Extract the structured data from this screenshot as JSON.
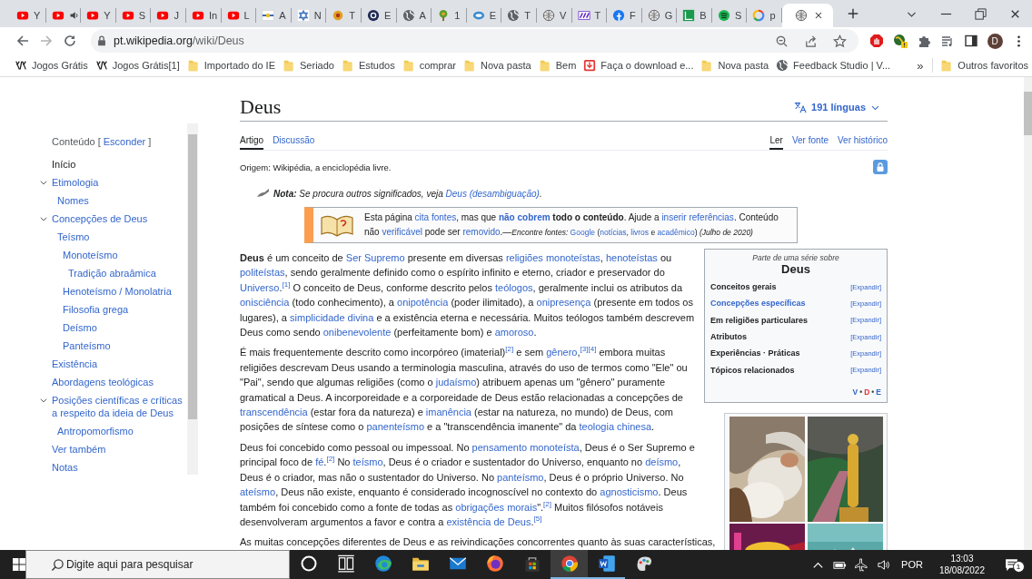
{
  "browser": {
    "tabs": [
      {
        "kind": "youtube",
        "title": "Y",
        "audio": false,
        "selected": false
      },
      {
        "kind": "youtube",
        "audio": true,
        "selected": false
      },
      {
        "kind": "youtube",
        "title": "Y",
        "audio": false,
        "selected": false
      },
      {
        "kind": "youtube",
        "title": "S",
        "audio": false,
        "selected": false
      },
      {
        "kind": "youtube",
        "title": "J",
        "audio": false,
        "selected": false
      },
      {
        "kind": "youtube",
        "title": "In",
        "audio": false,
        "selected": false
      },
      {
        "kind": "youtube",
        "title": "L",
        "audio": false,
        "selected": false
      },
      {
        "kind": "flag",
        "title": "A",
        "audio": false,
        "selected": false
      },
      {
        "kind": "star",
        "title": "N",
        "audio": false,
        "selected": false
      },
      {
        "kind": "sun",
        "title": "T",
        "audio": false,
        "selected": false
      },
      {
        "kind": "ring",
        "title": "E",
        "audio": false,
        "selected": false
      },
      {
        "kind": "globe",
        "title": "A",
        "audio": false,
        "selected": false
      },
      {
        "kind": "tree",
        "title": "1",
        "audio": false,
        "selected": false
      },
      {
        "kind": "cloud",
        "title": "E",
        "audio": false,
        "selected": false
      },
      {
        "kind": "globe",
        "title": "T",
        "audio": false,
        "selected": false
      },
      {
        "kind": "sphere",
        "title": "V",
        "audio": false,
        "selected": false
      },
      {
        "kind": "tag",
        "title": "T",
        "audio": false,
        "selected": false
      },
      {
        "kind": "social",
        "title": "F",
        "audio": false,
        "selected": false
      },
      {
        "kind": "sphere",
        "title": "G",
        "audio": false,
        "selected": false
      },
      {
        "kind": "book",
        "title": "B",
        "audio": false,
        "selected": false
      },
      {
        "kind": "music",
        "title": "S",
        "audio": false,
        "selected": false
      },
      {
        "kind": "colorring",
        "title": "p",
        "audio": false,
        "selected": false
      },
      {
        "kind": "sphere",
        "audio": false,
        "selected": true
      }
    ],
    "url": {
      "host": "pt.wikipedia.org",
      "path": "/wiki/Deus"
    },
    "profile": "D",
    "bookmarks": [
      {
        "label": "Jogos Grátis",
        "kind": "game"
      },
      {
        "label": "Jogos Grátis[1]",
        "kind": "game"
      },
      {
        "label": "Importado do IE",
        "kind": "folder"
      },
      {
        "label": "Seriado",
        "kind": "folder"
      },
      {
        "label": "Estudos",
        "kind": "folder"
      },
      {
        "label": "comprar",
        "kind": "folder"
      },
      {
        "label": "Nova pasta",
        "kind": "folder"
      },
      {
        "label": "Bem",
        "kind": "folder"
      },
      {
        "label": "Faça o download e...",
        "kind": "download"
      },
      {
        "label": "Nova pasta",
        "kind": "folder"
      },
      {
        "label": "Feedback Studio | V...",
        "kind": "globe"
      }
    ],
    "more_bookmarks": "»",
    "other_bookmarks": "Outros favoritos"
  },
  "toc": {
    "title": "Conteúdo",
    "bracket_open": "[",
    "toggle": "Esconder",
    "bracket_close": "]",
    "items": [
      {
        "label": "Início",
        "selected": true
      },
      {
        "label": "Etimologia",
        "selected": false,
        "expanded": true,
        "children": [
          {
            "label": "Nomes",
            "selected": false
          }
        ]
      },
      {
        "label": "Concepções de Deus",
        "selected": false,
        "expanded": true,
        "children": [
          {
            "label": "Teísmo",
            "selected": false,
            "children": [
              {
                "label": "Monoteísmo",
                "selected": false,
                "children": [
                  {
                    "label": "Tradição abraâmica",
                    "selected": false
                  }
                ]
              },
              {
                "label": "Henoteísmo / Monolatria",
                "selected": false
              },
              {
                "label": "Filosofia grega",
                "selected": false
              },
              {
                "label": "Deísmo",
                "selected": false
              },
              {
                "label": "Panteísmo",
                "selected": false
              }
            ]
          }
        ]
      },
      {
        "label": "Existência",
        "selected": false
      },
      {
        "label": "Abordagens teológicas",
        "selected": false
      },
      {
        "label": "Posições científicas e críticas a respeito da ideia de Deus",
        "selected": false,
        "expanded": true,
        "children": [
          {
            "label": "Antropomorfismo",
            "selected": false
          }
        ]
      },
      {
        "label": "Ver também",
        "selected": false
      },
      {
        "label": "Notas",
        "selected": false
      }
    ]
  },
  "article": {
    "title": "Deus",
    "languages": "191 línguas",
    "tabs": [
      {
        "label": "Artigo",
        "selected": true
      },
      {
        "label": "Discussão",
        "selected": false
      }
    ],
    "views": [
      {
        "label": "Ler",
        "selected": true
      },
      {
        "label": "Ver fonte",
        "selected": false
      },
      {
        "label": "Ver histórico",
        "selected": false
      }
    ],
    "tagline": "Origem: Wikipédia, a enciclopédia livre.",
    "hatnote": [
      {
        "kind": "bolditalic",
        "text": "Nota:"
      },
      {
        "kind": "text",
        "text": " Se procura outros significados, veja "
      },
      {
        "kind": "link",
        "text": "Deus (desambiguação)"
      },
      {
        "kind": "text",
        "text": "."
      }
    ],
    "notice": [
      {
        "kind": "text",
        "text": "Esta página "
      },
      {
        "kind": "link",
        "text": "cita fontes"
      },
      {
        "kind": "text",
        "text": ", mas que "
      },
      {
        "kind": "boldlink",
        "text": "não cobrem"
      },
      {
        "kind": "bold",
        "text": " todo o conteúdo"
      },
      {
        "kind": "text",
        "text": ". Ajude a "
      },
      {
        "kind": "link",
        "text": "inserir referências"
      },
      {
        "kind": "text",
        "text": ". Conteúdo não "
      },
      {
        "kind": "link",
        "text": "verificável"
      },
      {
        "kind": "text",
        "text": " pode ser "
      },
      {
        "kind": "link",
        "text": "removido"
      },
      {
        "kind": "text",
        "text": ".—"
      },
      {
        "kind": "smallitalic",
        "text": "Encontre fontes: "
      },
      {
        "kind": "smalllink",
        "text": "Google"
      },
      {
        "kind": "small",
        "text": " ("
      },
      {
        "kind": "smalllink",
        "text": "notícias"
      },
      {
        "kind": "small",
        "text": ", "
      },
      {
        "kind": "smalllink",
        "text": "livros"
      },
      {
        "kind": "small",
        "text": " e "
      },
      {
        "kind": "smalllink",
        "text": "acadêmico"
      },
      {
        "kind": "small",
        "text": ") "
      },
      {
        "kind": "smallitalic",
        "text": "(Julho de 2020)"
      }
    ],
    "infobox": {
      "caption": "Parte de uma série sobre",
      "title": "Deus",
      "rows": [
        {
          "label": "Conceitos gerais",
          "kind": "text",
          "action": "[Expandir]"
        },
        {
          "label": "Concepções específicas",
          "kind": "link",
          "action": "[Expandir]"
        },
        {
          "label": "Em religiões particulares",
          "kind": "text",
          "action": "[Expandir]"
        },
        {
          "label": "Atributos",
          "kind": "text",
          "action": "[Expandir]"
        },
        {
          "label": "Experiências · Práticas",
          "kind": "text",
          "action": "[Expandir]"
        },
        {
          "label": "Tópicos relacionados",
          "kind": "text",
          "action": "[Expandir]"
        }
      ],
      "footer": [
        {
          "label": "V",
          "color": "#3366cc"
        },
        {
          "separator": "•"
        },
        {
          "label": "D",
          "color": "#dd3333"
        },
        {
          "separator": "•"
        },
        {
          "label": "E",
          "color": "#3366cc"
        }
      ]
    },
    "gallery": [
      {
        "kind": "picture"
      },
      {
        "kind": "picture"
      },
      {
        "kind": "picture"
      },
      {
        "kind": "picture"
      }
    ],
    "paragraphs": [
      [
        {
          "kind": "bold",
          "text": "Deus"
        },
        {
          "kind": "text",
          "text": " é um conceito de "
        },
        {
          "kind": "link",
          "text": "Ser Supremo"
        },
        {
          "kind": "text",
          "text": " presente em diversas "
        },
        {
          "kind": "link",
          "text": "religiões monoteístas"
        },
        {
          "kind": "text",
          "text": ", "
        },
        {
          "kind": "link",
          "text": "henoteístas"
        },
        {
          "kind": "text",
          "text": " ou "
        },
        {
          "kind": "link",
          "text": "politeístas"
        },
        {
          "kind": "text",
          "text": ", sendo geralmente definido como o espírito infinito e eterno, criador e preservador do "
        },
        {
          "kind": "link",
          "text": "Universo"
        },
        {
          "kind": "text",
          "text": "."
        },
        {
          "kind": "ref",
          "text": "[1]"
        },
        {
          "kind": "text",
          "text": " O conceito de Deus, conforme descrito pelos "
        },
        {
          "kind": "link",
          "text": "teólogos"
        },
        {
          "kind": "text",
          "text": ", geralmente inclui os atributos da "
        },
        {
          "kind": "link",
          "text": "onisciência"
        },
        {
          "kind": "text",
          "text": " (todo conhecimento), a "
        },
        {
          "kind": "link",
          "text": "onipotência"
        },
        {
          "kind": "text",
          "text": " (poder ilimitado), a "
        },
        {
          "kind": "link",
          "text": "onipresença"
        },
        {
          "kind": "text",
          "text": " (presente em todos os lugares), a "
        },
        {
          "kind": "link",
          "text": "simplicidade divina"
        },
        {
          "kind": "text",
          "text": " e a existência eterna e necessária. Muitos teólogos também descrevem Deus como sendo "
        },
        {
          "kind": "link",
          "text": "onibenevolente"
        },
        {
          "kind": "text",
          "text": " (perfeitamente bom) e "
        },
        {
          "kind": "link",
          "text": "amoroso"
        },
        {
          "kind": "text",
          "text": "."
        }
      ],
      [
        {
          "kind": "text",
          "text": "É mais frequentemente descrito como incorpóreo (imaterial)"
        },
        {
          "kind": "ref",
          "text": "[2]"
        },
        {
          "kind": "text",
          "text": " e sem "
        },
        {
          "kind": "link",
          "text": "gênero"
        },
        {
          "kind": "text",
          "text": ","
        },
        {
          "kind": "ref",
          "text": "[3]"
        },
        {
          "kind": "ref",
          "text": "[4]"
        },
        {
          "kind": "text",
          "text": " embora muitas religiões descrevam Deus usando a terminologia masculina, através do uso de termos como \"Ele\" ou \"Pai\", sendo que algumas religiões (como o "
        },
        {
          "kind": "link",
          "text": "judaísmo"
        },
        {
          "kind": "text",
          "text": ") atribuem apenas um \"gênero\" puramente gramatical a Deus. A incorporeidade e a corporeidade de Deus estão relacionadas a concepções de "
        },
        {
          "kind": "link",
          "text": "transcendência"
        },
        {
          "kind": "text",
          "text": " (estar fora da natureza) e "
        },
        {
          "kind": "link",
          "text": "imanência"
        },
        {
          "kind": "text",
          "text": " (estar na natureza, no mundo) de Deus, com posições de síntese como o "
        },
        {
          "kind": "link",
          "text": "panenteísmo"
        },
        {
          "kind": "text",
          "text": " e a \"transcendência imanente\" da "
        },
        {
          "kind": "link",
          "text": "teologia chinesa"
        },
        {
          "kind": "text",
          "text": "."
        }
      ],
      [
        {
          "kind": "text",
          "text": "Deus foi concebido como pessoal ou impessoal. No "
        },
        {
          "kind": "link",
          "text": "pensamento monoteísta"
        },
        {
          "kind": "text",
          "text": ", Deus é o Ser Supremo e principal foco de "
        },
        {
          "kind": "link",
          "text": "fé"
        },
        {
          "kind": "text",
          "text": "."
        },
        {
          "kind": "ref",
          "text": "[2]"
        },
        {
          "kind": "text",
          "text": " No "
        },
        {
          "kind": "link",
          "text": "teísmo"
        },
        {
          "kind": "text",
          "text": ", Deus é o criador e sustentador do Universo, enquanto no "
        },
        {
          "kind": "link",
          "text": "deísmo"
        },
        {
          "kind": "text",
          "text": ", Deus é o criador, mas não o sustentador do Universo. No "
        },
        {
          "kind": "link",
          "text": "panteísmo"
        },
        {
          "kind": "text",
          "text": ", Deus é o próprio Universo. No "
        },
        {
          "kind": "link",
          "text": "ateísmo"
        },
        {
          "kind": "text",
          "text": ", Deus não existe, enquanto é considerado incognoscível no contexto do "
        },
        {
          "kind": "link",
          "text": "agnosticismo"
        },
        {
          "kind": "text",
          "text": ". Deus também foi concebido como a fonte de todas as "
        },
        {
          "kind": "link",
          "text": "obrigações morais"
        },
        {
          "kind": "text",
          "text": "\"."
        },
        {
          "kind": "ref",
          "text": "[2]"
        },
        {
          "kind": "text",
          "text": " Muitos filósofos notáveis desenvolveram argumentos a favor e contra a "
        },
        {
          "kind": "link",
          "text": "existência de Deus"
        },
        {
          "kind": "text",
          "text": "."
        },
        {
          "kind": "ref",
          "text": "[5]"
        }
      ],
      [
        {
          "kind": "text",
          "text": "As muitas concepções diferentes de Deus e as reivindicações concorrentes quanto às suas características,"
        }
      ]
    ]
  },
  "taskbar": {
    "search": {
      "placeholder": "Digite aqui para pesquisar"
    },
    "apps": [
      {
        "kind": "cortana",
        "open": false,
        "selected": false
      },
      {
        "kind": "taskview",
        "open": false,
        "selected": false
      },
      {
        "kind": "edge",
        "open": false,
        "selected": false
      },
      {
        "kind": "explorer",
        "open": false,
        "selected": false
      },
      {
        "kind": "mail",
        "open": false,
        "selected": false
      },
      {
        "kind": "firefox",
        "open": false,
        "selected": false
      },
      {
        "kind": "store",
        "open": false,
        "selected": false
      },
      {
        "kind": "chrome",
        "open": true,
        "selected": true
      },
      {
        "kind": "word",
        "open": true,
        "selected": false
      },
      {
        "kind": "paint",
        "open": false,
        "selected": false
      }
    ],
    "language": "POR",
    "time": "13:03",
    "date": "18/08/2022",
    "notifications": "1"
  }
}
